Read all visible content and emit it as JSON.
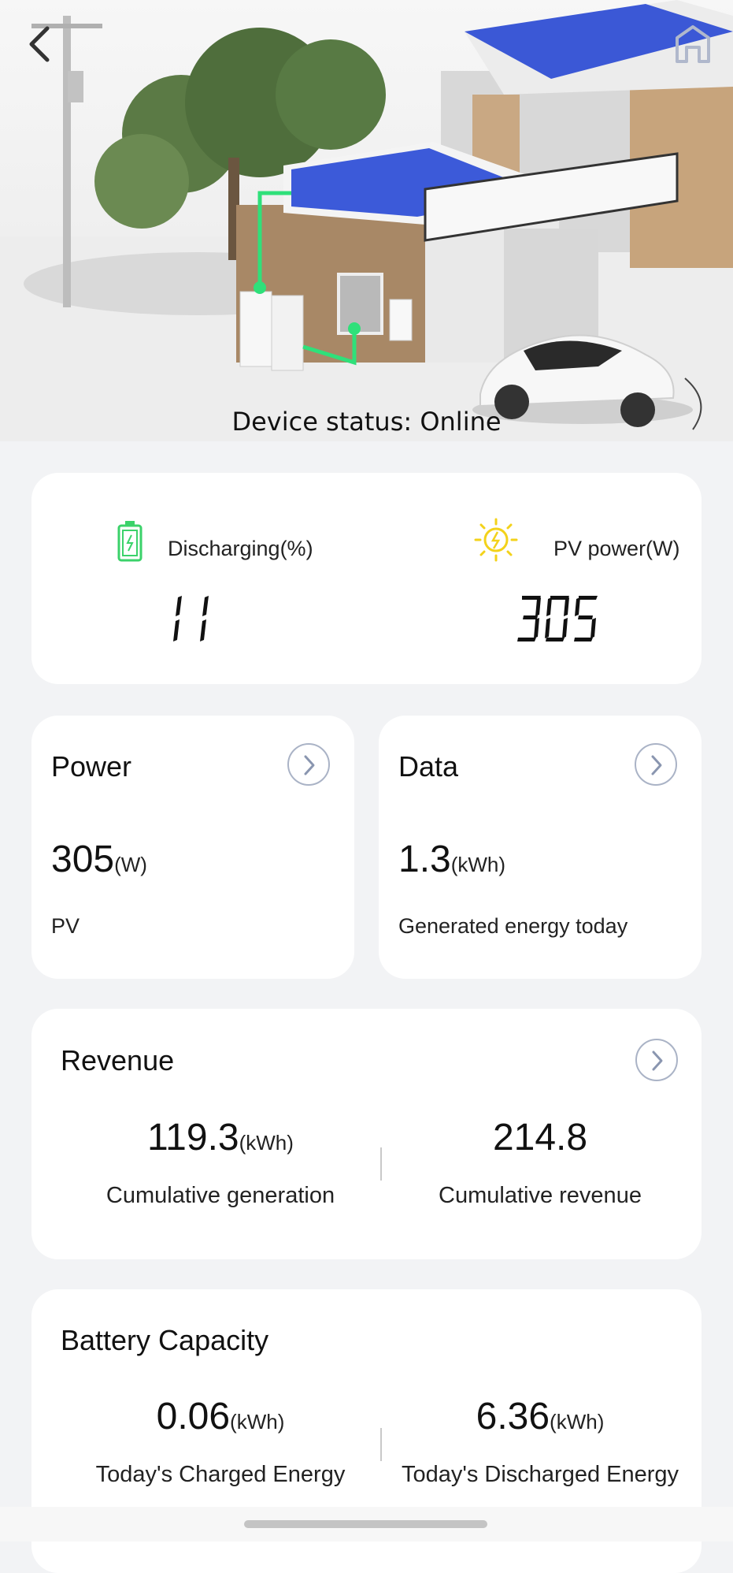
{
  "hero": {
    "status_text": "Device status: Online"
  },
  "top_metrics": [
    {
      "label": "Discharging(%)",
      "value": "11",
      "icon": "battery-icon",
      "color": "#3bd26a"
    },
    {
      "label": "PV power(W)",
      "value": "305",
      "icon": "sun-icon",
      "color": "#f3d21a"
    }
  ],
  "power_card": {
    "title": "Power",
    "value": "305",
    "unit": "(W)",
    "caption": "PV"
  },
  "data_card": {
    "title": "Data",
    "value": "1.3",
    "unit": "(kWh)",
    "caption": "Generated energy today"
  },
  "revenue_card": {
    "title": "Revenue",
    "left": {
      "value": "119.3",
      "unit": "(kWh)",
      "caption": "Cumulative generation"
    },
    "right": {
      "value": "214.8",
      "unit": "",
      "caption": "Cumulative revenue"
    }
  },
  "battery_card": {
    "title": "Battery Capacity",
    "left": {
      "value": "0.06",
      "unit": "(kWh)",
      "caption": "Today's Charged Energy"
    },
    "right": {
      "value": "6.36",
      "unit": "(kWh)",
      "caption": "Today's Discharged Energy"
    }
  },
  "colors": {
    "accent_arrow": "#8a96b0",
    "panel_blue": "#3b58d6",
    "flow_green": "#2fe07a"
  }
}
